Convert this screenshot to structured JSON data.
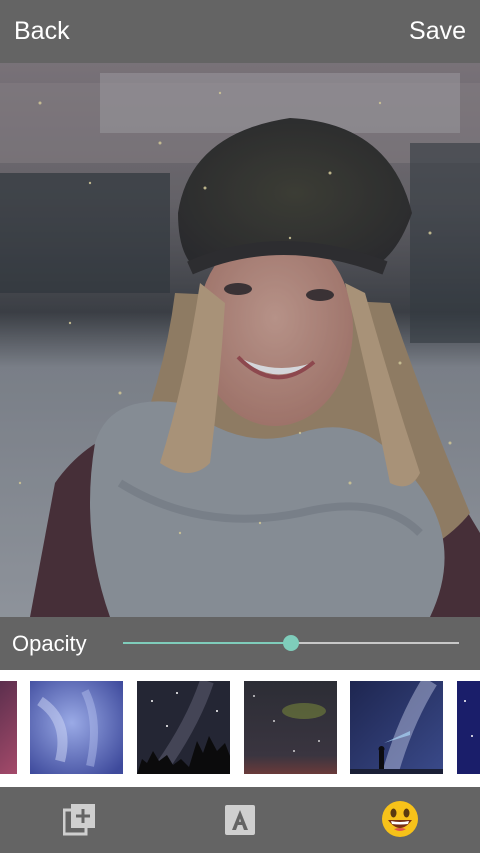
{
  "topbar": {
    "back_label": "Back",
    "save_label": "Save"
  },
  "editor": {
    "opacity_label": "Opacity",
    "opacity_value": 0.5
  },
  "filmstrip": {
    "items": [
      {
        "name": "galaxy-pink"
      },
      {
        "name": "blue-clouds"
      },
      {
        "name": "starry-trees"
      },
      {
        "name": "green-galaxy"
      },
      {
        "name": "milky-way-person"
      },
      {
        "name": "deep-blue-space"
      }
    ]
  },
  "toolbar": {
    "icons": [
      "add-sticker-icon",
      "text-icon",
      "emoji-icon"
    ]
  },
  "colors": {
    "bar_gray": "#646464",
    "slider_accent": "#7fcdbb",
    "emoji_yellow": "#f7c21a"
  }
}
